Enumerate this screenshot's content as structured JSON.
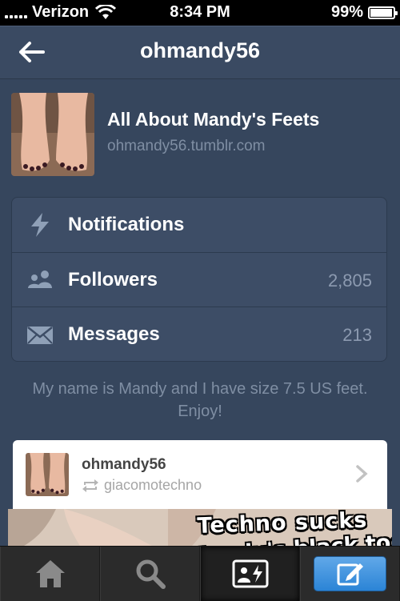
{
  "status": {
    "carrier": "Verizon",
    "time": "8:34 PM",
    "battery": "99%"
  },
  "nav": {
    "title": "ohmandy56"
  },
  "blog": {
    "title": "All About Mandy's Feets",
    "url": "ohmandy56.tumblr.com"
  },
  "menu": [
    {
      "label": "Notifications",
      "count": "",
      "icon": "lightning-icon"
    },
    {
      "label": "Followers",
      "count": "2,805",
      "icon": "people-icon"
    },
    {
      "label": "Messages",
      "count": "213",
      "icon": "envelope-icon"
    }
  ],
  "description": "My name is Mandy and I have size 7.5 US feet. Enjoy!",
  "post": {
    "author": "ohmandy56",
    "reblogged_from": "giacomotechno",
    "image_text_line1": "Techno sucks",
    "image_text_line2": "Mandy's black toes!"
  },
  "tabs": [
    {
      "name": "home",
      "icon": "home-icon"
    },
    {
      "name": "search",
      "icon": "search-icon"
    },
    {
      "name": "activity",
      "icon": "activity-icon"
    },
    {
      "name": "compose",
      "icon": "compose-icon"
    }
  ],
  "colors": {
    "background": "#36465d",
    "accent": "#2b84d6",
    "text_muted": "#7f8ea3"
  }
}
